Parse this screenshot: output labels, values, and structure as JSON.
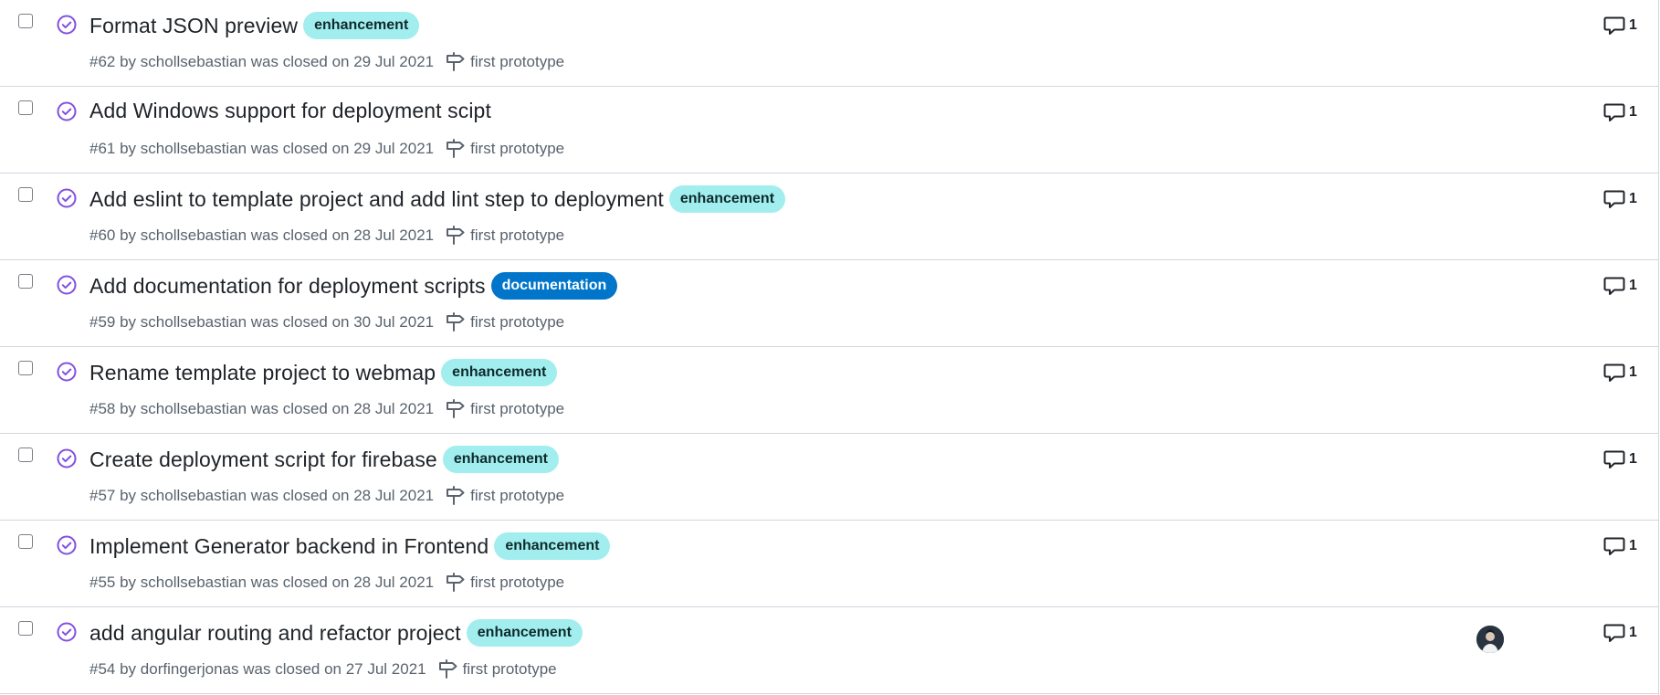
{
  "issues": [
    {
      "title": "Format JSON preview",
      "label": "enhancement",
      "label_type": "enhancement",
      "number": "#62",
      "author": "schollsebastian",
      "closed_text": "was closed on 29 Jul 2021",
      "milestone": "first prototype",
      "comments": "1"
    },
    {
      "title": "Add Windows support for deployment scipt",
      "label": "",
      "label_type": "",
      "number": "#61",
      "author": "schollsebastian",
      "closed_text": "was closed on 29 Jul 2021",
      "milestone": "first prototype",
      "comments": "1"
    },
    {
      "title": "Add eslint to template project and add lint step to deployment",
      "label": "enhancement",
      "label_type": "enhancement",
      "number": "#60",
      "author": "schollsebastian",
      "closed_text": "was closed on 28 Jul 2021",
      "milestone": "first prototype",
      "comments": "1"
    },
    {
      "title": "Add documentation for deployment scripts",
      "label": "documentation",
      "label_type": "documentation",
      "number": "#59",
      "author": "schollsebastian",
      "closed_text": "was closed on 30 Jul 2021",
      "milestone": "first prototype",
      "comments": "1"
    },
    {
      "title": "Rename template project to webmap",
      "label": "enhancement",
      "label_type": "enhancement",
      "number": "#58",
      "author": "schollsebastian",
      "closed_text": "was closed on 28 Jul 2021",
      "milestone": "first prototype",
      "comments": "1"
    },
    {
      "title": "Create deployment script for firebase",
      "label": "enhancement",
      "label_type": "enhancement",
      "number": "#57",
      "author": "schollsebastian",
      "closed_text": "was closed on 28 Jul 2021",
      "milestone": "first prototype",
      "comments": "1"
    },
    {
      "title": "Implement Generator backend in Frontend",
      "label": "enhancement",
      "label_type": "enhancement",
      "number": "#55",
      "author": "schollsebastian",
      "closed_text": "was closed on 28 Jul 2021",
      "milestone": "first prototype",
      "comments": "1"
    },
    {
      "title": "add angular routing and refactor project",
      "label": "enhancement",
      "label_type": "enhancement",
      "number": "#54",
      "author": "dorfingerjonas",
      "closed_text": "was closed on 27 Jul 2021",
      "milestone": "first prototype",
      "comments": "1",
      "assignee_avatar": true
    }
  ],
  "colors": {
    "closed_icon": "#8250df",
    "label_enhancement": "#a2eeef",
    "label_documentation": "#0075ca",
    "meta_text": "#59636e",
    "border": "#d0d7de"
  },
  "icons": {
    "state": "issue-closed-icon",
    "milestone": "milestone-icon",
    "comment": "comment-icon"
  }
}
